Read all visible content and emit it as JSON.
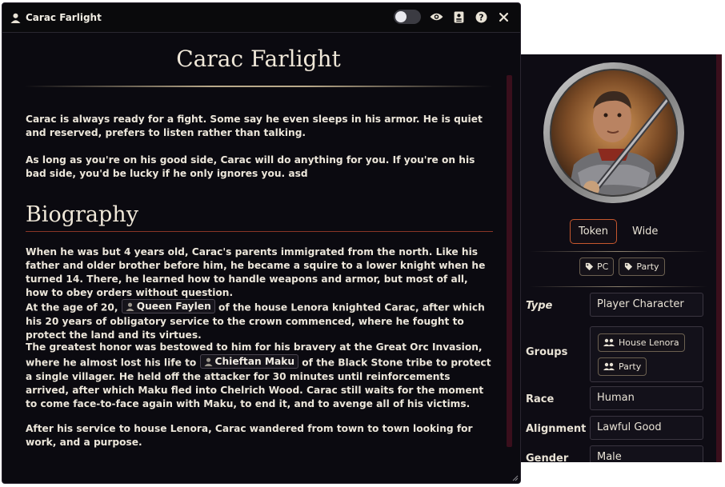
{
  "window": {
    "title": "Carac Farlight"
  },
  "page": {
    "heading": "Carac Farlight",
    "intro": [
      "Carac is always ready for a fight. Some say he even sleeps in his armor. He is quiet and reserved, prefers to listen rather than talking.",
      "As long as you're on his good side, Carac will do anything for you. If you're on his bad side, you'd be lucky if he only ignores you. asd"
    ],
    "biography_heading": "Biography",
    "bio1": "When he was but 4 years old, Carac's parents immigrated from the north. Like his father and older brother before him, he became a squire to a lower knight when he turned 14. There, he learned how to handle weapons and armor, but most of all, how to obey orders without question.",
    "bio2_pre": "At the age of 20,",
    "bio2_mention": "Queen Faylen",
    "bio2_post": "of the house Lenora knighted Carac, after which his 20 years of obligatory service to the crown commenced, where he fought to protect the land and its virtues.",
    "bio3_pre": "The greatest honor was bestowed to him for his bravery at the Great Orc Invasion, where he almost lost his life to",
    "bio3_mention": "Chieftan Maku",
    "bio3_post": "of the Black Stone tribe to protect a single villager. He held off the attacker for 30 minutes until reinforcements arrived, after which Maku fled into Chelrich Wood. Carac still waits for the moment to come face-to-face again with Maku, to end it, and to avenge all of his victims.",
    "bio4": "After his service to house Lenora, Carac wandered from town to town looking for work, and a purpose."
  },
  "sidebar": {
    "view_tabs": {
      "token": "Token",
      "wide": "Wide"
    },
    "tags": [
      "PC",
      "Party"
    ],
    "fields": {
      "type_label": "Type",
      "type_value": "Player Character",
      "groups_label": "Groups",
      "groups": [
        "House Lenora",
        "Party"
      ],
      "race_label": "Race",
      "race_value": "Human",
      "alignment_label": "Alignment",
      "alignment_value": "Lawful Good",
      "gender_label": "Gender",
      "gender_value": "Male"
    }
  },
  "colors": {
    "background": "#0b0a10",
    "scrollbar": "#3a0f1c",
    "accent_border": "#c6572e"
  }
}
